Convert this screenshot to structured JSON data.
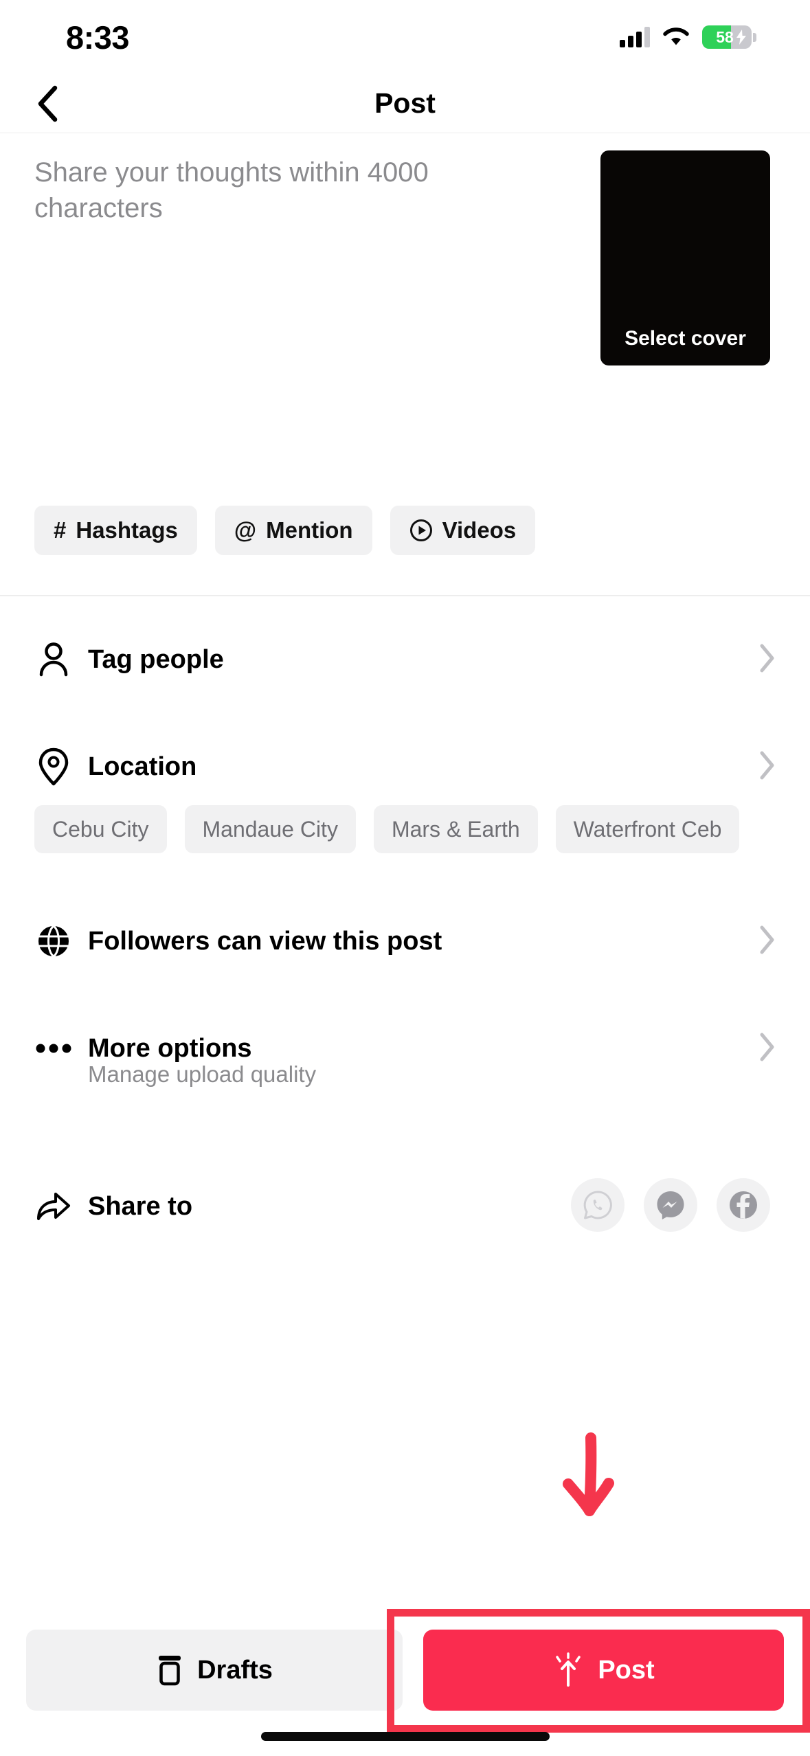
{
  "status_bar": {
    "time": "8:33",
    "battery_percent": "58",
    "battery_level": 58,
    "battery_color": "#2ed158",
    "signal_icon": "cellular-signal-icon",
    "wifi_icon": "wifi-icon",
    "charging_icon": "charging-bolt-icon"
  },
  "header": {
    "title": "Post",
    "back_icon": "back-chevron-icon"
  },
  "compose": {
    "placeholder": "Share your thoughts within 4000 characters",
    "value": "",
    "cover": {
      "label": "Select cover",
      "background": "#080605"
    },
    "chips": [
      {
        "icon": "hashtag-icon",
        "glyph": "#",
        "label": "Hashtags"
      },
      {
        "icon": "at-mention-icon",
        "glyph": "@",
        "label": "Mention"
      },
      {
        "icon": "play-circle-icon",
        "glyph": "",
        "label": "Videos"
      }
    ]
  },
  "rows": {
    "tag_people": {
      "icon": "person-icon",
      "label": "Tag people",
      "chevron": "chevron-right-icon"
    },
    "location": {
      "icon": "map-pin-icon",
      "label": "Location",
      "chevron": "chevron-right-icon"
    },
    "privacy": {
      "icon": "globe-icon",
      "label": "Followers can view this post",
      "chevron": "chevron-right-icon"
    },
    "more_options": {
      "icon": "ellipsis-icon",
      "label": "More options",
      "sublabel": "Manage upload quality",
      "chevron": "chevron-right-icon"
    },
    "share_to": {
      "icon": "share-arrow-icon",
      "label": "Share to"
    }
  },
  "location_suggestions": [
    "Cebu City",
    "Mandaue City",
    "Mars & Earth",
    "Waterfront Ceb"
  ],
  "share_targets": [
    {
      "icon": "whatsapp-icon",
      "name": "WhatsApp"
    },
    {
      "icon": "messenger-icon",
      "name": "Messenger"
    },
    {
      "icon": "facebook-icon",
      "name": "Facebook"
    }
  ],
  "bottom_bar": {
    "drafts_label": "Drafts",
    "drafts_icon": "drafts-icon",
    "post_label": "Post",
    "post_icon": "post-burst-icon",
    "post_color": "#fa2c4f"
  },
  "annotation": {
    "arrow_icon": "red-down-arrow-annotation",
    "highlight_color": "#f4364c"
  }
}
